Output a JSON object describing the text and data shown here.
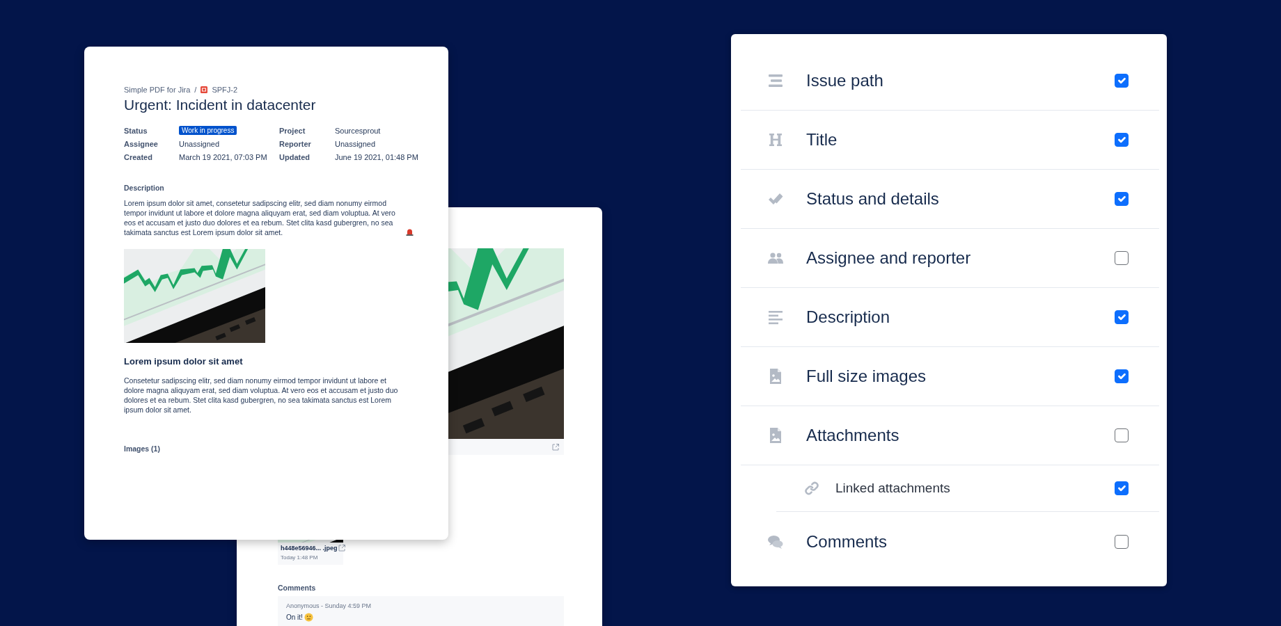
{
  "issue_document": {
    "breadcrumb": {
      "project": "Simple PDF for Jira",
      "separator": "/",
      "issue_key": "SPFJ-2"
    },
    "title": "Urgent: Incident in datacenter",
    "fields": [
      {
        "label": "Status",
        "value": "Work in progress",
        "kind": "lozenge"
      },
      {
        "label": "Project",
        "value": "Sourcesprout",
        "kind": "text"
      },
      {
        "label": "Assignee",
        "value": "Unassigned",
        "kind": "text"
      },
      {
        "label": "Reporter",
        "value": "Unassigned",
        "kind": "text"
      },
      {
        "label": "Created",
        "value": "March 19 2021, 07:03 PM",
        "kind": "text"
      },
      {
        "label": "Updated",
        "value": "June 19 2021, 01:48 PM",
        "kind": "text"
      }
    ],
    "description_label": "Description",
    "description": "Lorem ipsum dolor sit amet, consetetur sadipscing elitr, sed diam nonumy eirmod tempor invidunt ut labore et dolore magna aliquyam erat, sed diam voluptua. At vero eos et accusam et justo duo dolores et ea rebum. Stet clita kasd gubergren, no sea takimata sanctus est Lorem ipsum dolor sit amet.",
    "section_heading": "Lorem ipsum dolor sit amet",
    "section_text": "Consetetur sadipscing elitr, sed diam nonumy eirmod tempor invidunt ut labore et dolore magna aliquyam erat, sed diam voluptua. At vero eos et accusam et justo duo dolores et ea rebum. Stet clita kasd gubergren, no sea takimata sanctus est Lorem ipsum dolor sit amet.",
    "images_label": "Images (1)"
  },
  "attachments_document": {
    "attachment": {
      "file_name": "h448e56946... .jpeg",
      "date": "Today 1:48 PM"
    },
    "comments_label": "Comments",
    "comment": {
      "author_line": "Anonymous - Sunday 4:59 PM",
      "text": "On it!"
    }
  },
  "export_options": [
    {
      "label": "Issue path",
      "checked": true
    },
    {
      "label": "Title",
      "checked": true
    },
    {
      "label": "Status and details",
      "checked": true
    },
    {
      "label": "Assignee and reporter",
      "checked": false
    },
    {
      "label": "Description",
      "checked": true
    },
    {
      "label": "Full size images",
      "checked": true
    },
    {
      "label": "Attachments",
      "checked": false,
      "children": [
        {
          "label": "Linked attachments",
          "checked": true
        }
      ]
    },
    {
      "label": "Comments",
      "checked": false
    }
  ]
}
